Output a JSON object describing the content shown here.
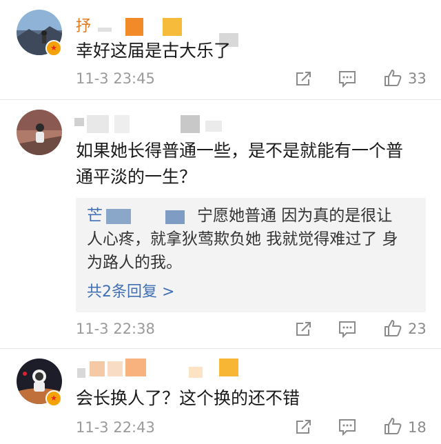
{
  "comments": [
    {
      "name_visible": "抒",
      "text": "幸好这届是古大乐了",
      "time": "11-3 23:45",
      "likes": "33"
    },
    {
      "text_lines": [
        "如果她长得普通一些，是不是就能有一个普",
        "通平淡的一生？"
      ],
      "time": "11-3 22:38",
      "likes": "23",
      "reply": {
        "line1_prefix": "芒",
        "line1_suffix": "宁愿她普通 因为真的是很让",
        "line2": "人心疼，就拿狄莺欺负她 我就觉得难过了 身",
        "line3": "为路人的我。",
        "more": "共2条回复 >"
      }
    },
    {
      "text": "会长换人了？这个换的还不错",
      "time": "11-3 22:43",
      "likes": "18"
    }
  ],
  "icons": {
    "share": "share-icon",
    "comment": "comment-icon",
    "like": "thumbs-up-icon",
    "badge": "verified-badge-icon"
  },
  "colors": {
    "username": "#e07a1f",
    "link": "#3f6fb5",
    "meta": "#9a9a9a"
  }
}
